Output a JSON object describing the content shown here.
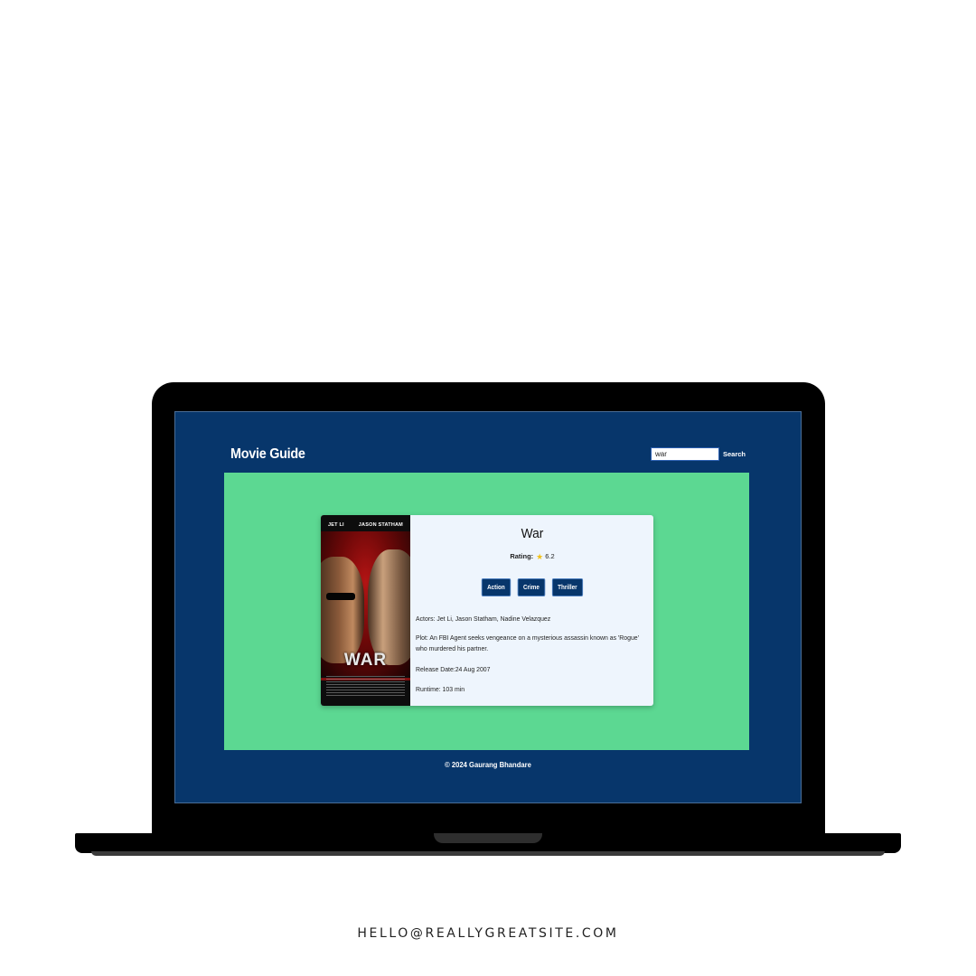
{
  "app": {
    "brand": "Movie Guide",
    "search": {
      "value": "war",
      "button_label": "Search"
    }
  },
  "movie": {
    "poster": {
      "top_names": [
        "JET LI",
        "JASON STATHAM"
      ],
      "title": "WAR"
    },
    "title": "War",
    "rating_label": "Rating:",
    "rating_value": "6.2",
    "genres": [
      "Action",
      "Crime",
      "Thriller"
    ],
    "actors": "Actors: Jet Li, Jason Statham, Nadine Velazquez",
    "plot": "Plot: An FBI Agent seeks vengeance on a mysterious assassin known as 'Rogue' who murdered his partner.",
    "release": "Release Date:24 Aug 2007",
    "runtime": "Runtime: 103 min"
  },
  "footer": {
    "copyright": "© 2024 Gaurang Bhandare"
  },
  "contact": {
    "email": "HELLO@REALLYGREATSITE.COM"
  },
  "colors": {
    "page_bg": "#ffffff",
    "header_bg": "#07366b",
    "content_bg": "#5cd892",
    "card_bg": "#eef5fd",
    "genre_bg": "#07366b",
    "star": "#f2c118"
  },
  "icons": {
    "rating": "star-icon"
  }
}
